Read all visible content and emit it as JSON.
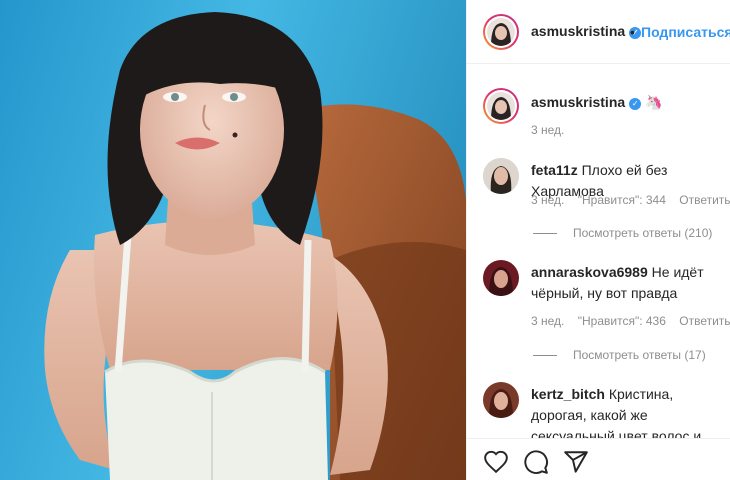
{
  "header": {
    "username": "asmuskristina",
    "follow_label": "Подписаться",
    "separator": "•"
  },
  "caption": {
    "username": "asmuskristina",
    "emoji": "🦄",
    "time": "3 нед."
  },
  "comments": [
    {
      "username": "feta11z",
      "text": "Плохо ей без Харламова",
      "time": "3 нед.",
      "likes": "\"Нравится\": 344",
      "reply": "Ответить",
      "view_replies": "Посмотреть ответы (210)"
    },
    {
      "username": "annaraskova6989",
      "text": "Не идёт чёрный, ну вот правда",
      "time": "3 нед.",
      "likes": "\"Нравится\": 436",
      "reply": "Ответить",
      "view_replies": "Посмотреть ответы (17)"
    },
    {
      "username": "kertz_bitch",
      "text": "Кристина, дорогая, какой же сексуальный цвет волос и образ! Вам очень идёт"
    }
  ],
  "actions": {
    "like_icon": "heart-icon",
    "comment_icon": "comment-icon",
    "share_icon": "send-icon"
  },
  "colors": {
    "accent": "#3897f0",
    "text": "#262626",
    "muted": "#8e8e8e"
  }
}
